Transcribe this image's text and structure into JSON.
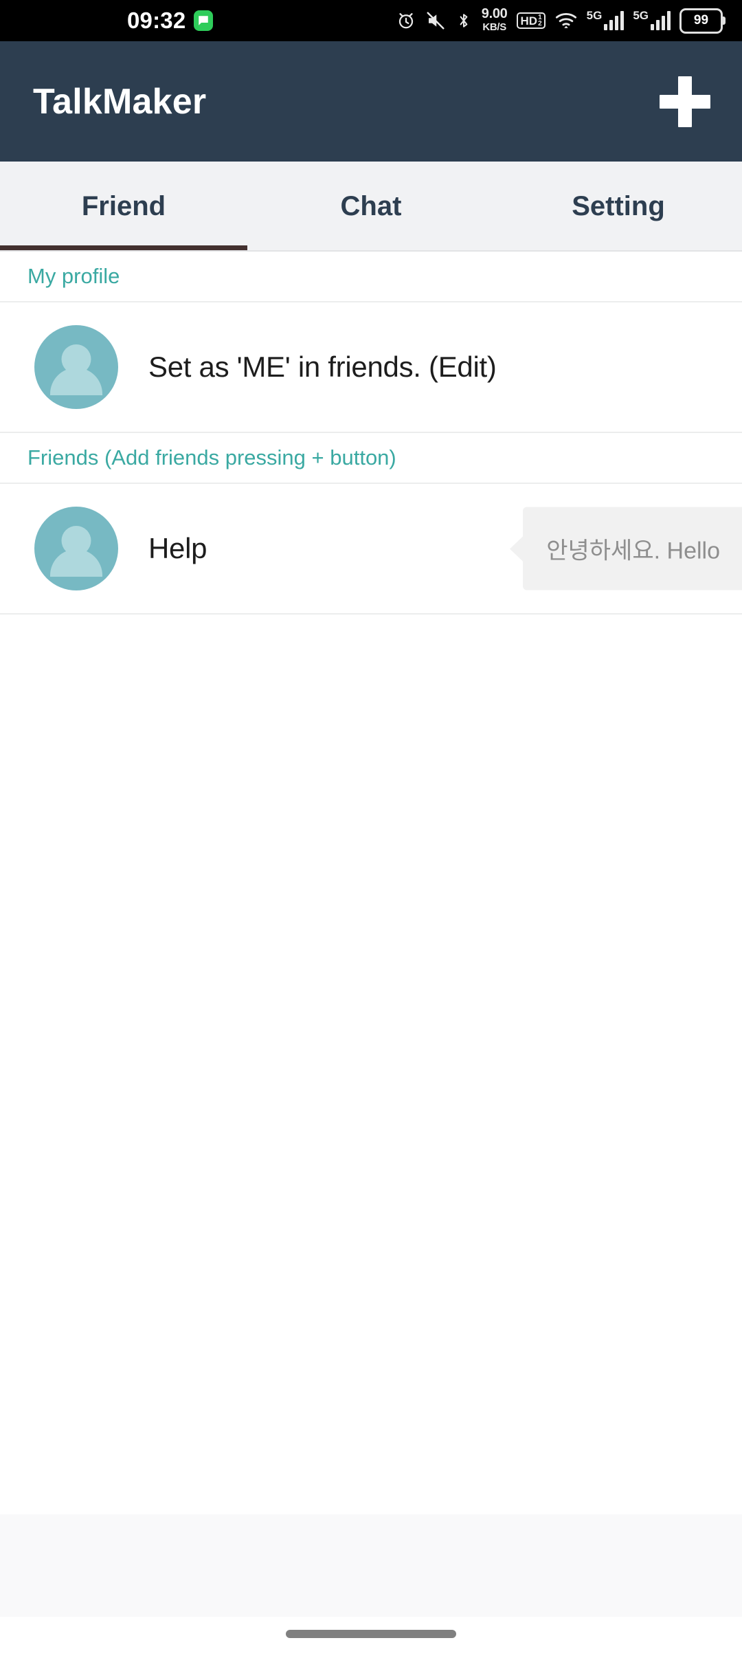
{
  "status_bar": {
    "clock": "09:32",
    "notification_icon": "message-icon",
    "icons": [
      "alarm-icon",
      "mute-icon",
      "bluetooth-icon",
      "network-speed",
      "hd-icon",
      "wifi-icon",
      "signal-5g-1",
      "signal-5g-2",
      "battery-icon"
    ],
    "network_speed_value": "9.00",
    "network_speed_unit": "KB/S",
    "hd_label": "HD",
    "hd_superscript": "1",
    "hd_subscript": "2",
    "sim1_label": "5G",
    "sim2_label": "5G",
    "battery_level": "99"
  },
  "app_bar": {
    "title": "TalkMaker",
    "add_button_label": "+",
    "background_color": "#2d3e50"
  },
  "tabs": {
    "active_index": 0,
    "indicator_color": "#43312f",
    "items": [
      {
        "label": "Friend"
      },
      {
        "label": "Chat"
      },
      {
        "label": "Setting"
      }
    ]
  },
  "sections": [
    {
      "header": "My profile",
      "header_color": "#3aa9a2",
      "rows": [
        {
          "avatar": "person-placeholder-icon",
          "name": "Set as 'ME' in friends. (Edit)",
          "bubble": null
        }
      ]
    },
    {
      "header": "Friends (Add friends pressing + button)",
      "header_color": "#3aa9a2",
      "rows": [
        {
          "avatar": "person-placeholder-icon",
          "name": "Help",
          "bubble": "안녕하세요. Hello"
        }
      ]
    }
  ],
  "bottom": {
    "gesture_bar": "home-gesture-bar"
  }
}
